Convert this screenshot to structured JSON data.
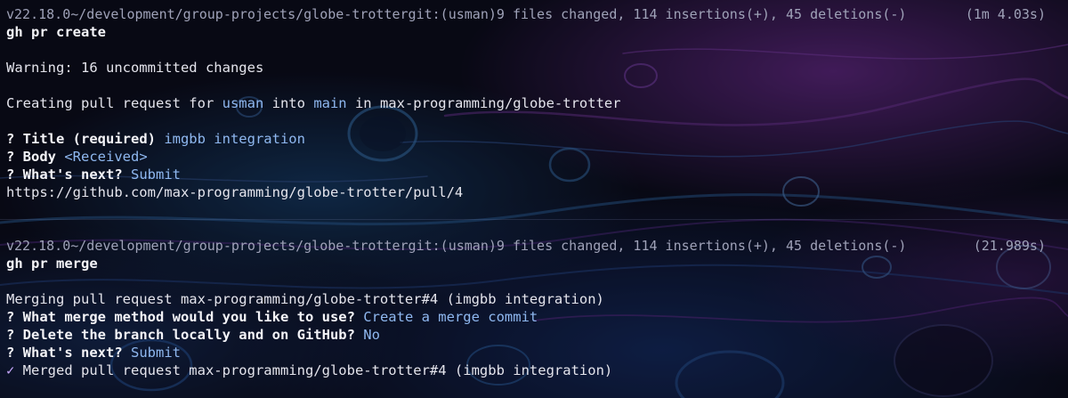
{
  "colors": {
    "background": "#0a0b18",
    "accent_purple": "#5b1f7a",
    "accent_blue": "#1d4e7c",
    "text": "#e4e4ec",
    "dim_text": "#9fa2b8",
    "highlight": "#8fb8f0"
  },
  "session1": {
    "prompt": {
      "node": "v22.18.0",
      "path": "~/development/group-projects/globe-trotter",
      "git": "git:(usman)",
      "changes": "9 files changed, 114 insertions(+), 45 deletions(-)",
      "duration": "(1m 4.03s)"
    },
    "command": "gh pr create",
    "warning": "Warning: 16 uncommitted changes",
    "creating": {
      "prefix": "Creating pull request for ",
      "branch": "usman",
      "into": " into ",
      "base": "main",
      "in": " in ",
      "repo": "max-programming/globe-trotter"
    },
    "title_q": {
      "mark": "? ",
      "label": "Title (required)",
      "value": " imgbb integration"
    },
    "body_q": {
      "mark": "? ",
      "label": "Body",
      "value": " <Received>"
    },
    "next_q": {
      "mark": "? ",
      "label": "What's next?",
      "value": " Submit"
    },
    "url": "https://github.com/max-programming/globe-trotter/pull/4"
  },
  "session2": {
    "prompt": {
      "node": "v22.18.0",
      "path": "~/development/group-projects/globe-trotter",
      "git": "git:(usman)",
      "changes": "9 files changed, 114 insertions(+), 45 deletions(-)",
      "duration": "(21.989s)"
    },
    "command": "gh pr merge",
    "merging": "Merging pull request max-programming/globe-trotter#4 (imgbb integration)",
    "method_q": {
      "mark": "? ",
      "label": "What merge method would you like to use?",
      "value": " Create a merge commit"
    },
    "delete_q": {
      "mark": "? ",
      "label": "Delete the branch locally and on GitHub?",
      "value": " No"
    },
    "next_q": {
      "mark": "? ",
      "label": "What's next?",
      "value": " Submit"
    },
    "merged": {
      "mark": "✓",
      "text": " Merged pull request max-programming/globe-trotter#4 (imgbb integration)"
    }
  }
}
